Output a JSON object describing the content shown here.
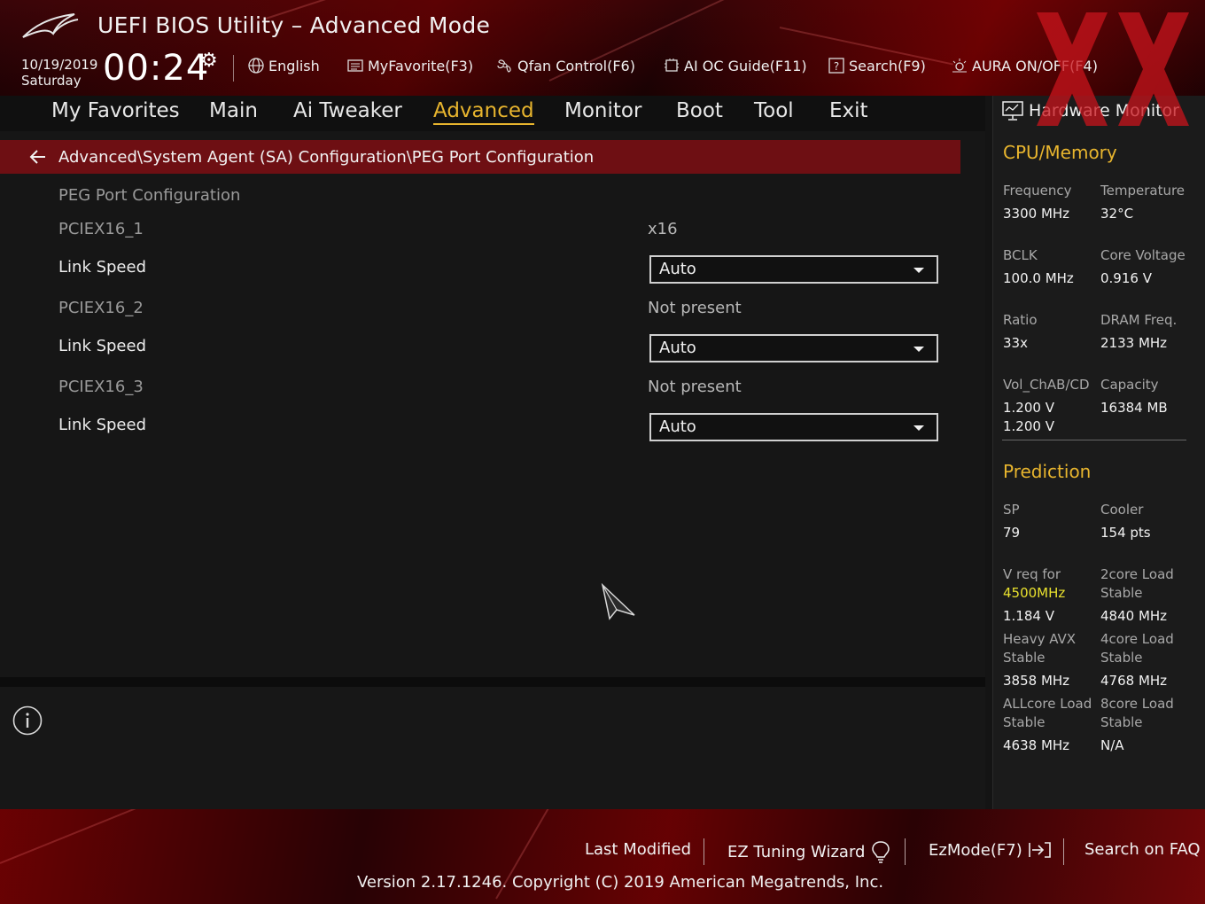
{
  "header": {
    "title": "UEFI BIOS Utility – Advanced Mode",
    "date": "10/19/2019",
    "day": "Saturday",
    "time": "00:24",
    "tools": [
      {
        "label": "English",
        "icon": "globe-icon"
      },
      {
        "label": "MyFavorite(F3)",
        "icon": "favorite-list-icon"
      },
      {
        "label": "Qfan Control(F6)",
        "icon": "fan-icon"
      },
      {
        "label": "AI OC Guide(F11)",
        "icon": "ai-chip-icon"
      },
      {
        "label": "Search(F9)",
        "icon": "help-box-icon"
      },
      {
        "label": "AURA ON/OFF(F4)",
        "icon": "aura-light-icon"
      }
    ]
  },
  "tabs": [
    {
      "label": "My Favorites"
    },
    {
      "label": "Main"
    },
    {
      "label": "Ai Tweaker"
    },
    {
      "label": "Advanced",
      "active": true
    },
    {
      "label": "Monitor"
    },
    {
      "label": "Boot"
    },
    {
      "label": "Tool"
    },
    {
      "label": "Exit"
    }
  ],
  "breadcrumb": "Advanced\\System Agent (SA) Configuration\\PEG Port Configuration",
  "settings": {
    "section_title": "PEG Port Configuration",
    "rows": [
      {
        "label": "PCIEX16_1",
        "value": "x16"
      },
      {
        "label": "Link Speed",
        "dropdown": "Auto"
      },
      {
        "label": "PCIEX16_2",
        "value": "Not present"
      },
      {
        "label": "Link Speed",
        "dropdown": "Auto"
      },
      {
        "label": "PCIEX16_3",
        "value": "Not present"
      },
      {
        "label": "Link Speed",
        "dropdown": "Auto"
      }
    ]
  },
  "hw_monitor": {
    "title": "Hardware Monitor",
    "cpu_memory": {
      "heading": "CPU/Memory",
      "frequency_label": "Frequency",
      "frequency": "3300 MHz",
      "temperature_label": "Temperature",
      "temperature": "32°C",
      "bclk_label": "BCLK",
      "bclk": "100.0 MHz",
      "core_voltage_label": "Core Voltage",
      "core_voltage": "0.916 V",
      "ratio_label": "Ratio",
      "ratio": "33x",
      "dram_freq_label": "DRAM Freq.",
      "dram_freq": "2133 MHz",
      "vol_label": "Vol_ChAB/CD",
      "vol_ab": "1.200 V",
      "vol_cd": "1.200 V",
      "capacity_label": "Capacity",
      "capacity": "16384 MB"
    },
    "prediction": {
      "heading": "Prediction",
      "sp_label": "SP",
      "sp": "79",
      "cooler_label": "Cooler",
      "cooler": "154 pts",
      "vreq_label": "V req for",
      "vreq_freq": "4500MHz",
      "vreq": "1.184 V",
      "core2_label_a": "2core Load",
      "core2_label_b": "Stable",
      "core2": "4840 MHz",
      "heavy_label_a": "Heavy AVX",
      "heavy_label_b": "Stable",
      "heavy": "3858 MHz",
      "core4_label_a": "4core Load",
      "core4_label_b": "Stable",
      "core4": "4768 MHz",
      "allcore_label_a": "ALLcore Load",
      "allcore_label_b": "Stable",
      "allcore": "4638 MHz",
      "core8_label_a": "8core Load",
      "core8_label_b": "Stable",
      "core8": "N/A"
    }
  },
  "footer": {
    "last_modified": "Last Modified",
    "ez_tuning": "EZ Tuning Wizard",
    "ezmode": "EzMode(F7)",
    "search_faq": "Search on FAQ",
    "version": "Version 2.17.1246. Copyright (C) 2019 American Megatrends, Inc."
  },
  "colors": {
    "accent": "#e8b52e",
    "breadcrumb_bg": "#6e0f13",
    "highlight": "#e8e02e"
  }
}
